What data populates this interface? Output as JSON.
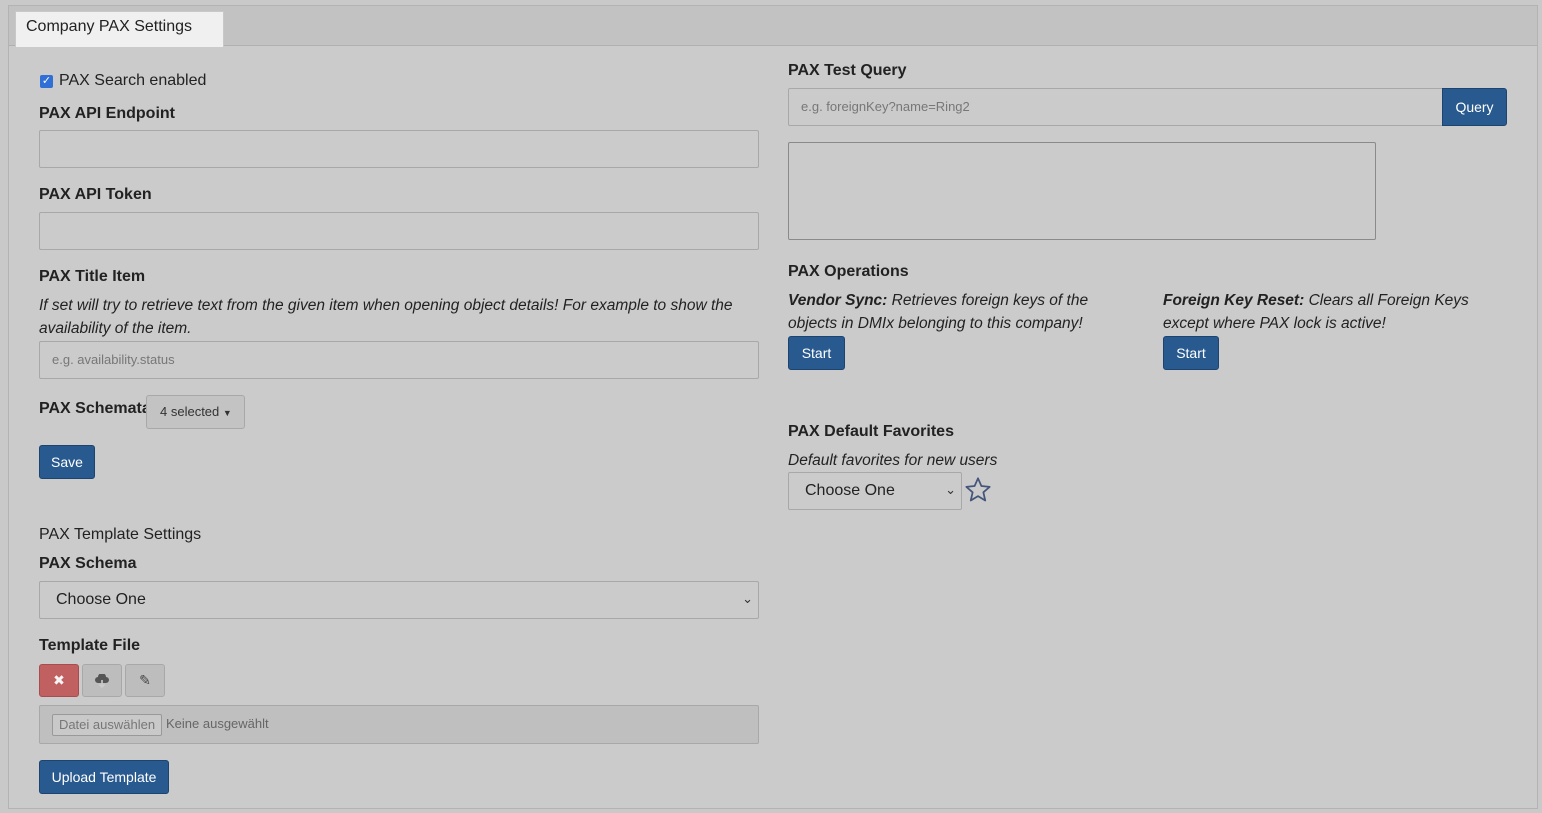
{
  "tab": {
    "title": "Company PAX Settings"
  },
  "left": {
    "search_enabled_label": "PAX Search enabled",
    "search_enabled_checked": true,
    "api_endpoint_label": "PAX API Endpoint",
    "api_endpoint_value": "",
    "api_token_label": "PAX API Token",
    "api_token_value": "",
    "title_item_label": "PAX Title Item",
    "title_item_help": "If set will try to retrieve text from the given item when opening object details! For example to show the availability of the item.",
    "title_item_placeholder": "e.g. availability.status",
    "schemata_label": "PAX Schemata",
    "schemata_dropdown": "4 selected",
    "save_label": "Save",
    "template_section_title": "PAX Template Settings",
    "schema_label": "PAX Schema",
    "schema_selected": "Choose One",
    "template_file_label": "Template File",
    "file_choose_label": "Datei auswählen",
    "file_none_label": "Keine ausgewählt",
    "upload_label": "Upload Template"
  },
  "right": {
    "test_query_label": "PAX Test Query",
    "test_query_placeholder": "e.g. foreignKey?name=Ring2",
    "query_button": "Query",
    "operations_label": "PAX Operations",
    "vendor_sync_title": "Vendor Sync:",
    "vendor_sync_desc": " Retrieves foreign keys of the objects in DMIx belonging to this company!",
    "vendor_sync_start": "Start",
    "fk_reset_title": "Foreign Key Reset:",
    "fk_reset_desc": " Clears all Foreign Keys except where PAX lock is active!",
    "fk_reset_start": "Start",
    "favorites_label": "PAX Default Favorites",
    "favorites_help": "Default favorites for new users",
    "favorites_selected": "Choose One"
  },
  "colors": {
    "primary_button": "#285a8f",
    "danger_button": "#c06060",
    "checkbox": "#2f6fd6",
    "background": "#cbcbcb"
  },
  "icons": {
    "remove": "close-icon",
    "download": "cloud-download-icon",
    "edit": "pencil-icon",
    "favorite": "star-icon",
    "dropdown": "chevron-down-icon"
  }
}
